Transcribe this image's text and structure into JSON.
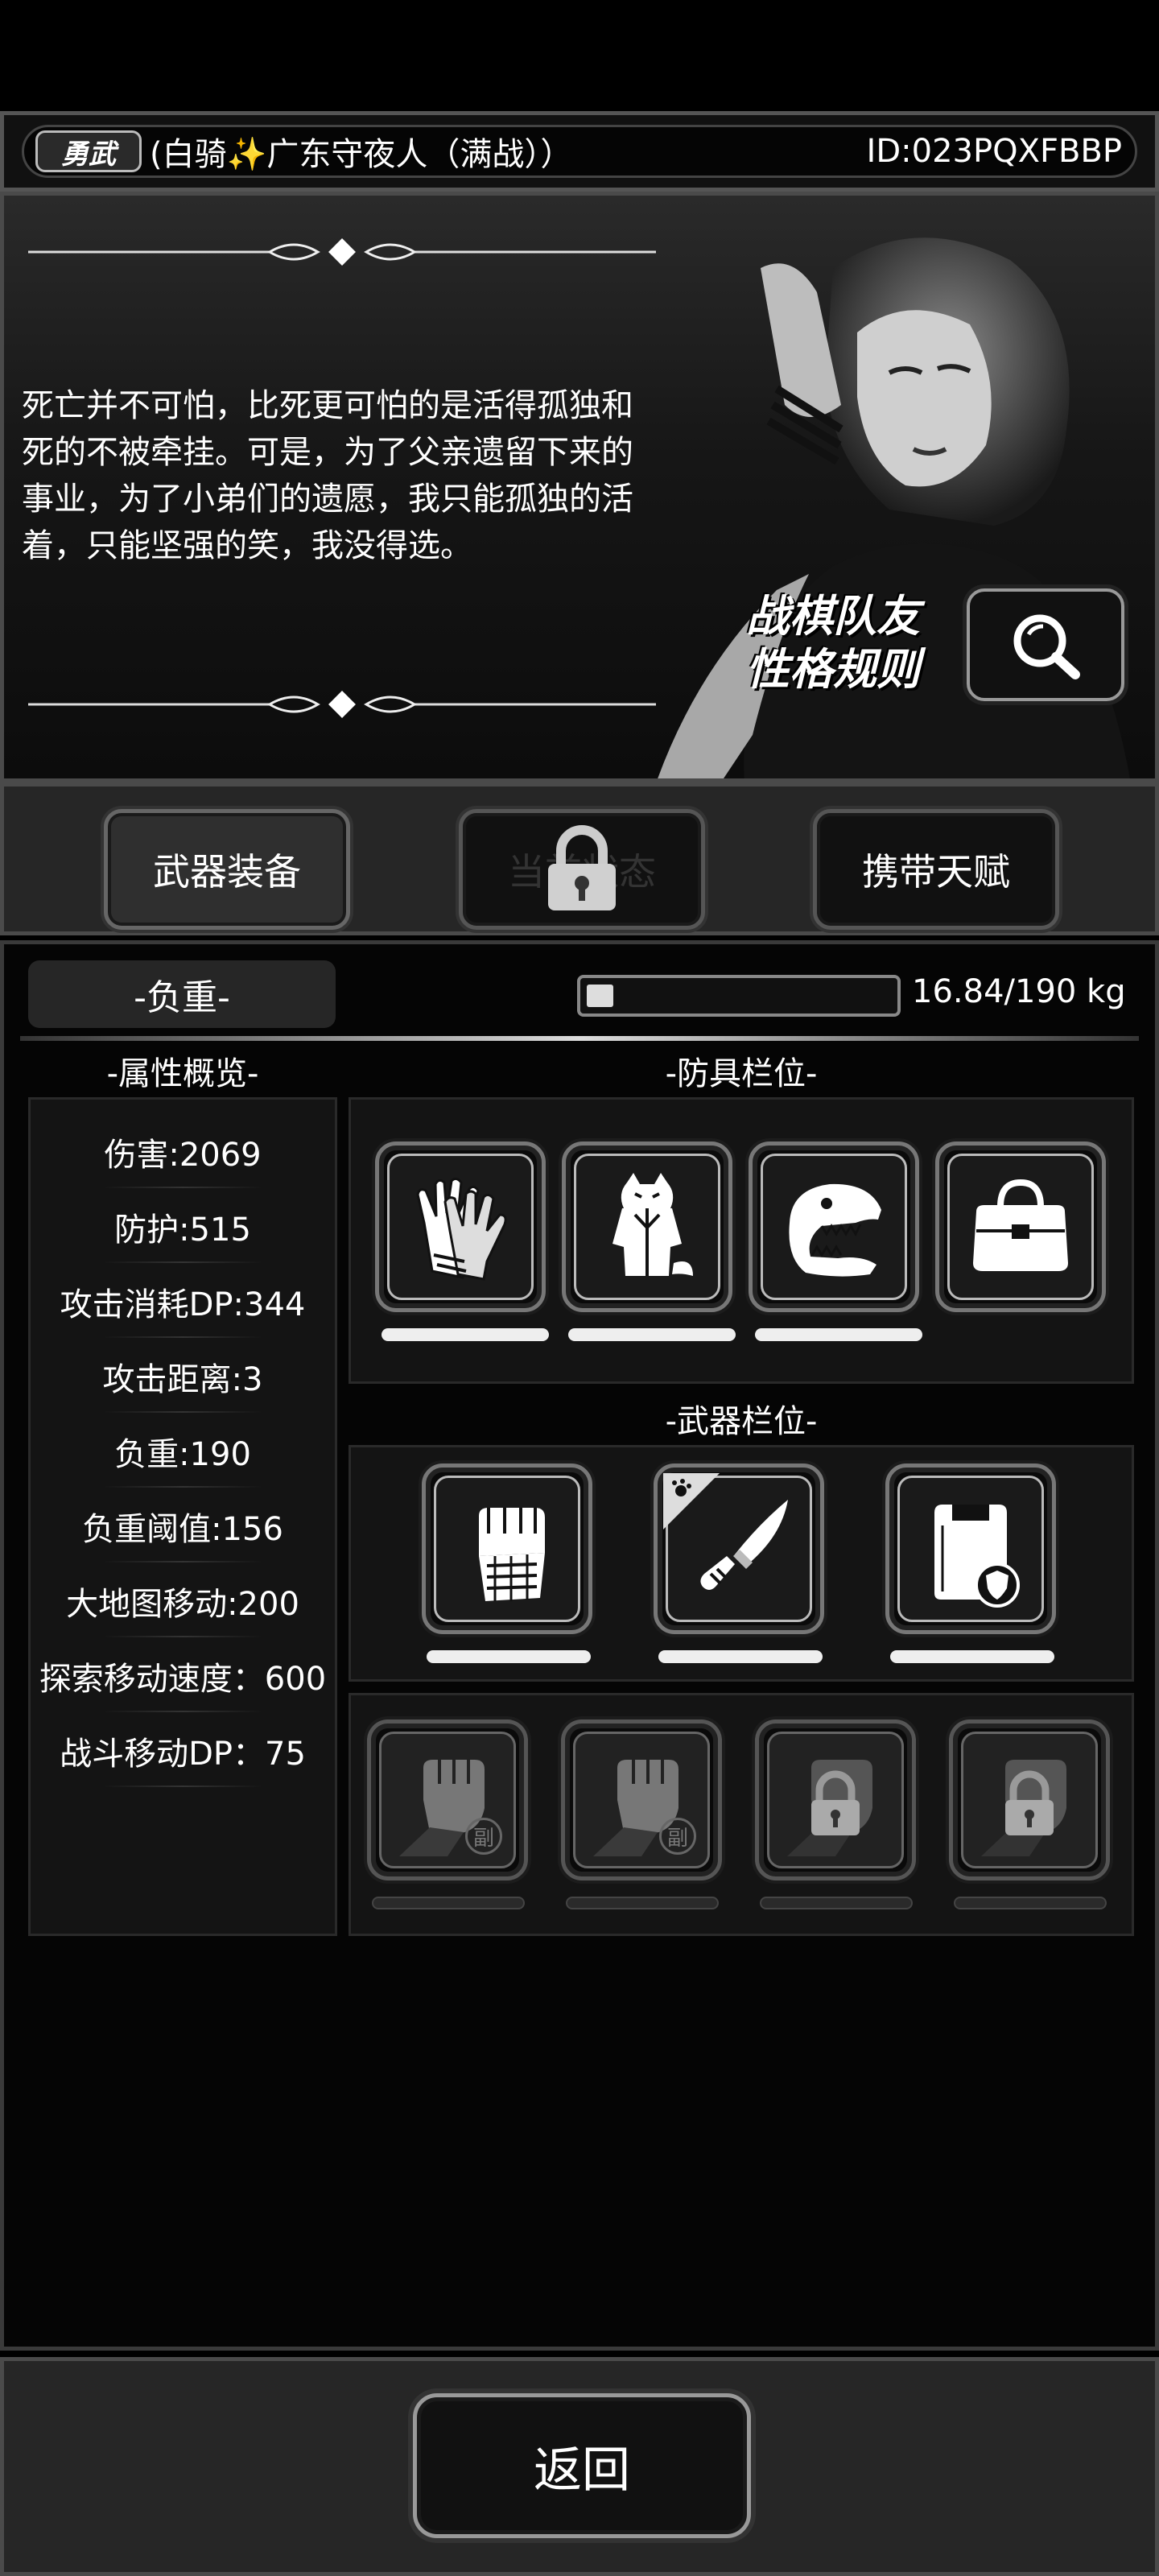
{
  "header": {
    "rank_badge": "勇武",
    "player_name": "(白骑✨广东守夜人（满战））",
    "player_id": "ID:023PQXFBBP"
  },
  "banner": {
    "story": "死亡并不可怕，比死更可怕的是活得孤独和死的不被牵挂。可是，为了父亲遗留下来的事业，为了小弟们的遗愿，我只能孤独的活着，只能坚强的笑，我没得选。",
    "rules_line1": "战棋队友",
    "rules_line2": "性格规则",
    "search_icon": "magnifier-icon"
  },
  "tabs": [
    {
      "label": "武器装备",
      "state": "active"
    },
    {
      "label": "当前状态",
      "state": "locked"
    },
    {
      "label": "携带天赋",
      "state": "normal"
    }
  ],
  "load": {
    "label": "-负重-",
    "current": 16.84,
    "max": 190,
    "fill_fraction": 0.0886,
    "text": "16.84/190 kg"
  },
  "stats": {
    "title": "-属性概览-",
    "items": [
      "伤害:2069",
      "防护:515",
      "攻击消耗DP:344",
      "攻击距离:3",
      "负重:190",
      "负重阈值:156",
      "大地图移动:200",
      "探索移动速度：600",
      "战斗移动DP：75"
    ]
  },
  "armor": {
    "title": "-防具栏位-",
    "slots": [
      {
        "icon": "gloves-icon",
        "durability": 1.0
      },
      {
        "icon": "hoodie-icon",
        "durability": 1.0
      },
      {
        "icon": "dinosaur-head-icon",
        "durability": 1.0
      },
      {
        "icon": "bag-icon",
        "durability": null
      }
    ]
  },
  "weapons": {
    "title": "-武器栏位-",
    "slots": [
      {
        "icon": "armored-fist-icon",
        "durability": 1.0
      },
      {
        "icon": "knife-icon",
        "durability": 1.0
      },
      {
        "icon": "riot-shield-icon",
        "durability": 1.0
      }
    ]
  },
  "secondary": {
    "slots": [
      {
        "icon": "fist-icon",
        "tag": "副",
        "locked": false
      },
      {
        "icon": "fist-icon",
        "tag": "副",
        "locked": false
      },
      {
        "icon": "fist-icon",
        "tag": "",
        "locked": true
      },
      {
        "icon": "fist-icon",
        "tag": "",
        "locked": true
      }
    ]
  },
  "footer": {
    "back_label": "返回"
  }
}
